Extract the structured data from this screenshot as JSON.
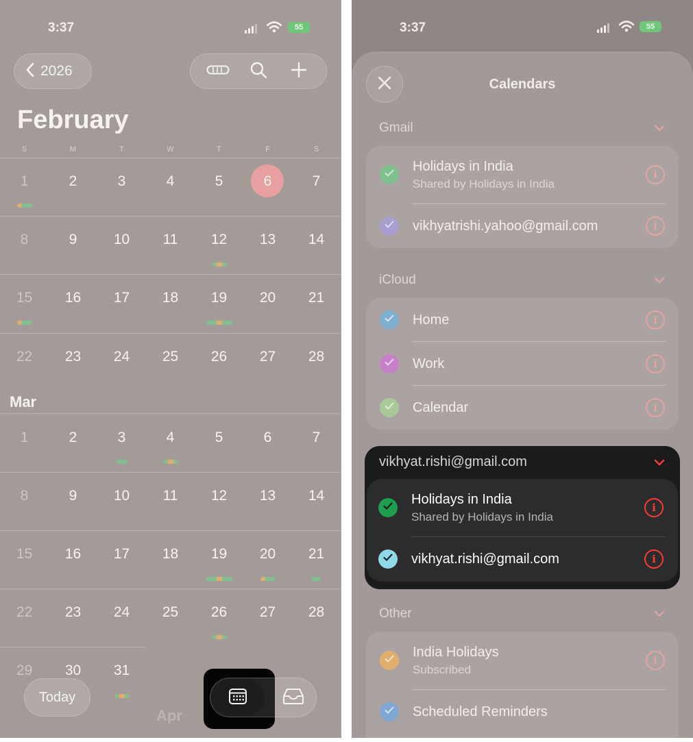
{
  "left": {
    "status": {
      "time": "3:37",
      "battery": "55"
    },
    "nav": {
      "year": "2026"
    },
    "month_title": "February",
    "dow": [
      "S",
      "M",
      "T",
      "W",
      "T",
      "F",
      "S"
    ],
    "feb_weeks": [
      [
        "1",
        "2",
        "3",
        "4",
        "5",
        "6",
        "7"
      ],
      [
        "8",
        "9",
        "10",
        "11",
        "12",
        "13",
        "14"
      ],
      [
        "15",
        "16",
        "17",
        "18",
        "19",
        "20",
        "21"
      ],
      [
        "22",
        "23",
        "24",
        "25",
        "26",
        "27",
        "28"
      ]
    ],
    "today_day": "6",
    "mar_label": "Mar",
    "mar_weeks": [
      [
        "1",
        "2",
        "3",
        "4",
        "5",
        "6",
        "7"
      ],
      [
        "8",
        "9",
        "10",
        "11",
        "12",
        "13",
        "14"
      ],
      [
        "15",
        "16",
        "17",
        "18",
        "19",
        "20",
        "21"
      ],
      [
        "22",
        "23",
        "24",
        "25",
        "26",
        "27",
        "28"
      ],
      [
        "29",
        "30",
        "31"
      ]
    ],
    "apr_label": "Apr",
    "today_button": "Today",
    "accent_today": "#e7a0a0"
  },
  "right": {
    "status": {
      "time": "3:37",
      "battery": "55"
    },
    "sheet_title": "Calendars",
    "groups": {
      "gmail": {
        "title": "Gmail",
        "items": [
          {
            "name": "Holidays in India",
            "sub": "Shared by Holidays in India",
            "color": "#7fc08e"
          },
          {
            "name": "vikhyatrishi.yahoo@gmail.com",
            "color": "#a89ed2"
          }
        ]
      },
      "icloud": {
        "title": "iCloud",
        "items": [
          {
            "name": "Home",
            "color": "#7fb0cf"
          },
          {
            "name": "Work",
            "color": "#c77fc7"
          },
          {
            "name": "Calendar",
            "color": "#a9c999"
          }
        ]
      },
      "vikhyat": {
        "title": "vikhyat.rishi@gmail.com",
        "items": [
          {
            "name": "Holidays in India",
            "sub": "Shared by Holidays in India",
            "color": "#1f9e4f"
          },
          {
            "name": "vikhyat.rishi@gmail.com",
            "color": "#8fd9e8"
          }
        ]
      },
      "other": {
        "title": "Other",
        "items": [
          {
            "name": "India Holidays",
            "sub": "Subscribed",
            "color": "#e0ad6e"
          },
          {
            "name": "Scheduled Reminders",
            "color": "#7fa7d3"
          }
        ]
      }
    },
    "accent_info": "#ff3b30"
  }
}
